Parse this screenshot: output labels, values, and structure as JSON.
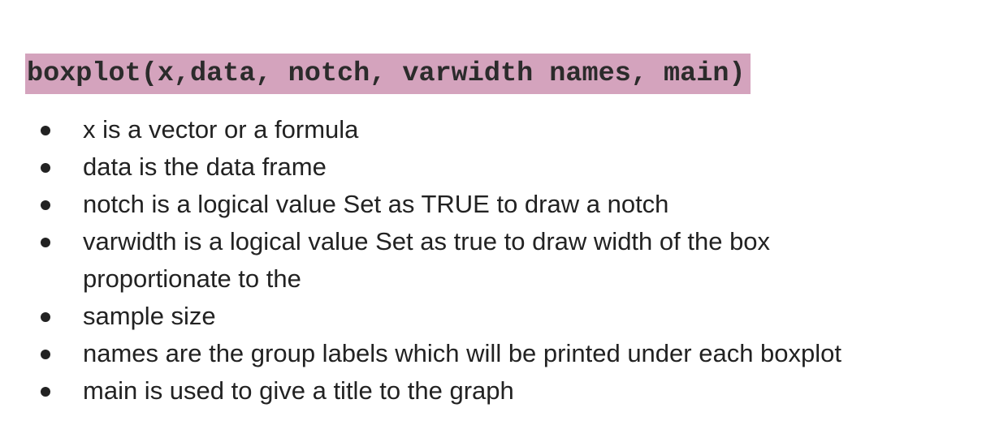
{
  "code": {
    "signature": "boxplot(x,data, notch, varwidth names, main)",
    "highlight_color": "#d4a3bd"
  },
  "bullets": [
    {
      "text": "x is a vector or a formula"
    },
    {
      "text": "data is the data frame"
    },
    {
      "text": "notch is a logical value Set as TRUE to draw a notch"
    },
    {
      "text": "varwidth is a logical value Set as true to draw width of the box proportionate to the"
    },
    {
      "text": "sample size"
    },
    {
      "text": "names are the group labels which will be printed under each boxplot"
    },
    {
      "text": "main is used to give a title to the graph"
    }
  ]
}
